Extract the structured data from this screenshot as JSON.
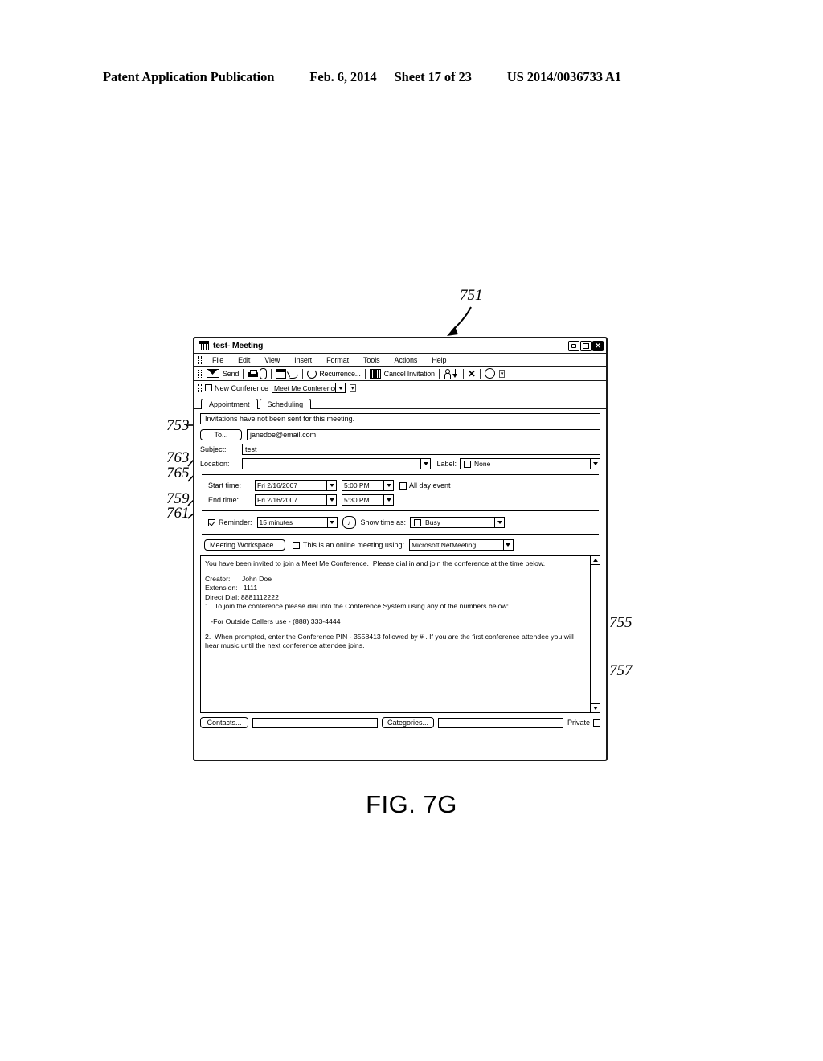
{
  "page": {
    "header": {
      "publication": "Patent Application Publication",
      "date": "Feb. 6, 2014",
      "sheet": "Sheet 17 of 23",
      "patent_number": "US 2014/0036733 A1"
    },
    "figure_label": "FIG. 7G"
  },
  "reference_numerals": {
    "window": "751",
    "info_bar": "753",
    "subject_row": "763",
    "location_row": "765",
    "start_time_row": "759",
    "end_time_row": "761",
    "body_intro": "755",
    "body_instructions": "757"
  },
  "window": {
    "title": "test- Meeting",
    "icon": "meeting-window-icon",
    "controls": {
      "minimize": "minimize-button",
      "maximize": "maximize-button",
      "close": "close-button",
      "close_glyph": "✕"
    },
    "menu": [
      {
        "label": "File",
        "accel": "F"
      },
      {
        "label": "Edit",
        "accel": "E"
      },
      {
        "label": "View",
        "accel": "V"
      },
      {
        "label": "Insert",
        "accel": "I"
      },
      {
        "label": "Format",
        "accel": "o"
      },
      {
        "label": "Tools",
        "accel": "T"
      },
      {
        "label": "Actions",
        "accel": "A"
      },
      {
        "label": "Help",
        "accel": "H"
      }
    ],
    "toolbar": {
      "send_label": "Send",
      "recurrence_label": "Recurrence...",
      "cancel_invitation_label": "Cancel Invitation",
      "icons": [
        "send-icon",
        "print-icon",
        "attach-icon",
        "assign-task-icon",
        "check-names-icon",
        "recurrence-icon",
        "cancel-invitation-icon",
        "invite-attendees-icon",
        "importance-low-icon",
        "delete-icon",
        "clock-icon"
      ],
      "overflow_label": "▾"
    },
    "conference_toolbar": {
      "new_conference_label": "New Conference",
      "new_conference_checked": false,
      "conference_type_value": "Meet Me Conference",
      "overflow_label": "▾"
    },
    "tabs": [
      {
        "label": "Appointment",
        "active": true
      },
      {
        "label": "Scheduling",
        "active": false
      }
    ],
    "info_bar_text": "Invitations have not been sent for this meeting.",
    "form": {
      "to_button_label": "To...",
      "to_value": "janedoe@email.com",
      "subject_label": "Subject:",
      "subject_value": "test",
      "location_label": "Location:",
      "location_value": "",
      "label_label": "Label:",
      "label_value": "None",
      "label_checked": false,
      "start_time_label": "Start time:",
      "start_date_value": "Fri 2/16/2007",
      "start_clock_value": "5:00 PM",
      "end_time_label": "End time:",
      "end_date_value": "Fri 2/16/2007",
      "end_clock_value": "5:30 PM",
      "all_day_label": "All day event",
      "all_day_checked": false,
      "reminder_label": "Reminder:",
      "reminder_checked": true,
      "reminder_value": "15 minutes",
      "sound_icon": "reminder-sound-icon",
      "show_time_as_label": "Show time as:",
      "show_time_as_value": "Busy",
      "show_time_as_checked": false,
      "meeting_workspace_label": "Meeting Workspace...",
      "online_meeting_label": "This is an online meeting using:",
      "online_meeting_checked": false,
      "online_meeting_value": "Microsoft NetMeeting"
    },
    "body": {
      "intro": "You have been invited to join a Meet Me Conference.  Please dial in and join the conference at the time below.",
      "creator_line": "Creator:      John Doe",
      "extension_line": "Extension:   1111",
      "direct_dial_line": "Direct Dial: 8881112222",
      "step1": "1.  To join the conference please dial into the Conference System using any of the numbers below:",
      "outside_callers": "   -For Outside Callers use - (888) 333-4444",
      "step2": "2.  When prompted, enter the Conference PIN - 3558413 followed by # . If you are the first conference attendee you will hear music until the next conference attendee joins."
    },
    "bottom_bar": {
      "contacts_label": "Contacts...",
      "contacts_value": "",
      "categories_label": "Categories...",
      "categories_value": "",
      "private_label": "Private",
      "private_checked": false
    }
  }
}
